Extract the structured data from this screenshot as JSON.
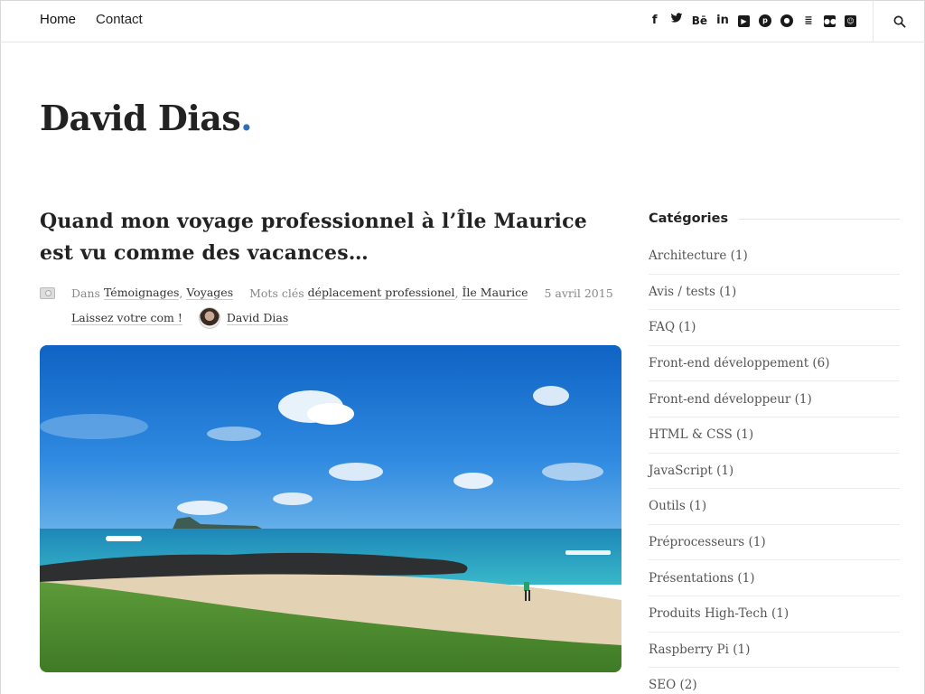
{
  "nav": {
    "items": [
      {
        "label": "Home"
      },
      {
        "label": "Contact"
      }
    ]
  },
  "social": [
    "facebook-icon",
    "twitter-icon",
    "behance-icon",
    "linkedin-icon",
    "youtube-icon",
    "pinterest-icon",
    "github-icon",
    "stackoverflow-icon",
    "flickr-icon",
    "slideshare-icon"
  ],
  "site": {
    "title": "David Dias",
    "dot": ".",
    "accent": "#2f6eb5"
  },
  "post": {
    "title": "Quand mon voyage professionnel à l’Île Maurice est vu comme des vacances…",
    "in_label": "Dans",
    "category_1": "Témoignages",
    "category_2": "Voyages",
    "tags_label": "Mots clés",
    "tag_1": "déplacement professionel",
    "tag_2": "Île Maurice",
    "date": "5 avril 2015",
    "comment_link": "Laissez votre com !",
    "author": "David Dias"
  },
  "sidebar": {
    "title": "Catégories",
    "categories": [
      {
        "label": "Architecture (1)"
      },
      {
        "label": "Avis / tests (1)"
      },
      {
        "label": "FAQ (1)"
      },
      {
        "label": "Front-end développement (6)"
      },
      {
        "label": "Front-end développeur (1)"
      },
      {
        "label": "HTML & CSS (1)"
      },
      {
        "label": "JavaScript (1)"
      },
      {
        "label": "Outils (1)"
      },
      {
        "label": "Préprocesseurs (1)"
      },
      {
        "label": "Présentations (1)"
      },
      {
        "label": "Produits High-Tech (1)"
      },
      {
        "label": "Raspberry Pi (1)"
      },
      {
        "label": "SEO (2)"
      }
    ]
  }
}
